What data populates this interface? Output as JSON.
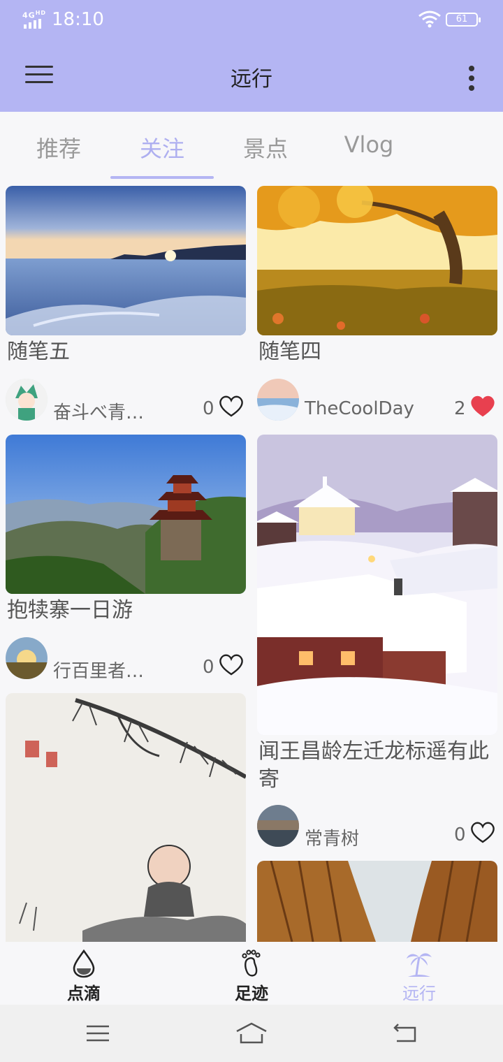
{
  "status_bar": {
    "network": "4G",
    "network_badge": "HD",
    "time": "18:10",
    "battery": "61"
  },
  "app_bar": {
    "title": "远行"
  },
  "tabs": [
    {
      "label": "推荐",
      "active": false
    },
    {
      "label": "关注",
      "active": true
    },
    {
      "label": "景点",
      "active": false
    },
    {
      "label": "Vlog",
      "active": false
    }
  ],
  "posts": [
    {
      "title": "随笔五",
      "author": "奋斗べ青…",
      "likes": "0",
      "liked": false
    },
    {
      "title": "随笔四",
      "author": "TheCoolDay",
      "likes": "2",
      "liked": true
    },
    {
      "title": "抱犊寨一日游",
      "author": "行百里者…",
      "likes": "0",
      "liked": false
    },
    {
      "title": "闻王昌龄左迁龙标遥有此寄",
      "author": "常青树",
      "likes": "0",
      "liked": false
    }
  ],
  "bottom_nav": [
    {
      "label": "点滴",
      "icon": "water-drop-icon",
      "active": false
    },
    {
      "label": "足迹",
      "icon": "footprint-icon",
      "active": false
    },
    {
      "label": "远行",
      "icon": "palm-tree-icon",
      "active": true
    }
  ],
  "colors": {
    "accent": "#b4b5f3",
    "like_red": "#e8404f"
  }
}
